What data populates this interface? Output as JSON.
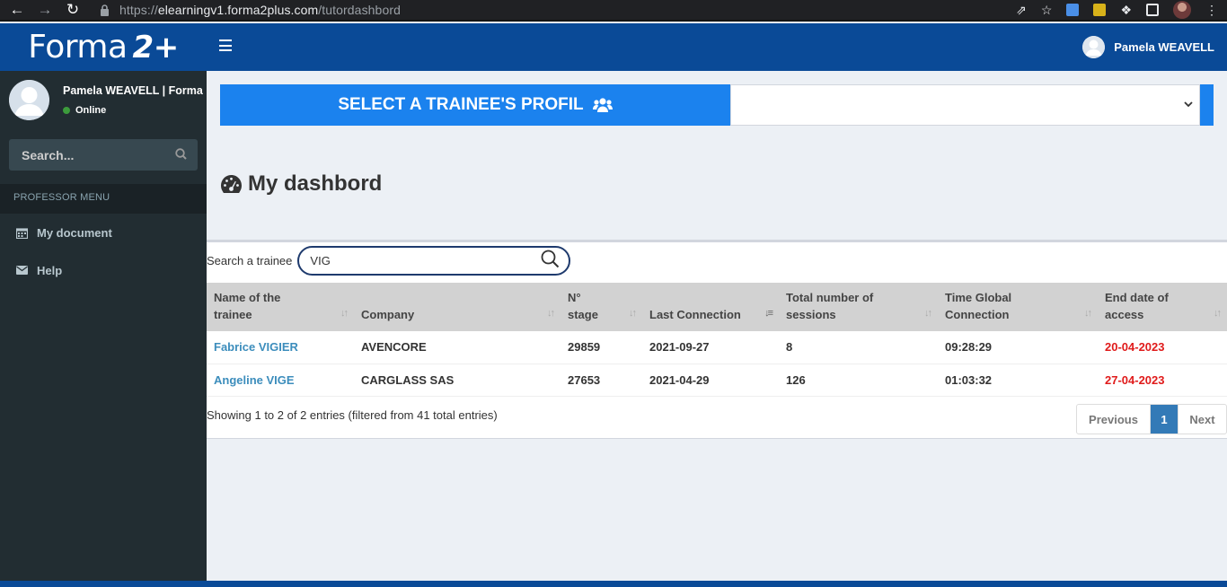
{
  "browser": {
    "url_prefix": "https://",
    "url_host": "elearningv1.forma2plus.com",
    "url_path": "/tutordashbord"
  },
  "header": {
    "logo_text": "Forma",
    "logo_suffix": "2+",
    "user_name": "Pamela WEAVELL"
  },
  "sidebar": {
    "user_name": "Pamela WEAVELL | Forma",
    "status": "Online",
    "search_placeholder": "Search...",
    "menu_header": "PROFESSOR MENU",
    "items": [
      {
        "label": "My document",
        "icon": "calendar-icon"
      },
      {
        "label": "Help",
        "icon": "envelope-icon"
      }
    ]
  },
  "main": {
    "select_label": "SELECT A TRAINEE'S PROFIL",
    "select_value": "",
    "title": "My dashbord",
    "search_label": "Search a trainee",
    "search_value": "VIG",
    "table": {
      "columns": [
        {
          "line1": "Name of the",
          "line2": "trainee"
        },
        {
          "line1": "",
          "line2": "Company"
        },
        {
          "line1": "N°",
          "line2": "stage"
        },
        {
          "line1": "",
          "line2": "Last Connection"
        },
        {
          "line1": "Total number of",
          "line2": "sessions"
        },
        {
          "line1": "Time Global",
          "line2": "Connection"
        },
        {
          "line1": "End date of",
          "line2": "access"
        }
      ],
      "rows": [
        [
          "Fabrice VIGIER",
          "AVENCORE",
          "29859",
          "2021-09-27",
          "8",
          "09:28:29",
          "20-04-2023"
        ],
        [
          "Angeline VIGE",
          "CARGLASS SAS",
          "27653",
          "2021-04-29",
          "126",
          "01:03:32",
          "27-04-2023"
        ]
      ]
    },
    "info": "Showing 1 to 2 of 2 entries (filtered from 41 total entries)",
    "pager": {
      "previous": "Previous",
      "current": "1",
      "next": "Next"
    }
  },
  "colors": {
    "header": "#0a4a97",
    "sidebar": "#222d32",
    "accent": "#1b82ee",
    "link": "#3c8dbc",
    "danger": "#e01b1b"
  }
}
